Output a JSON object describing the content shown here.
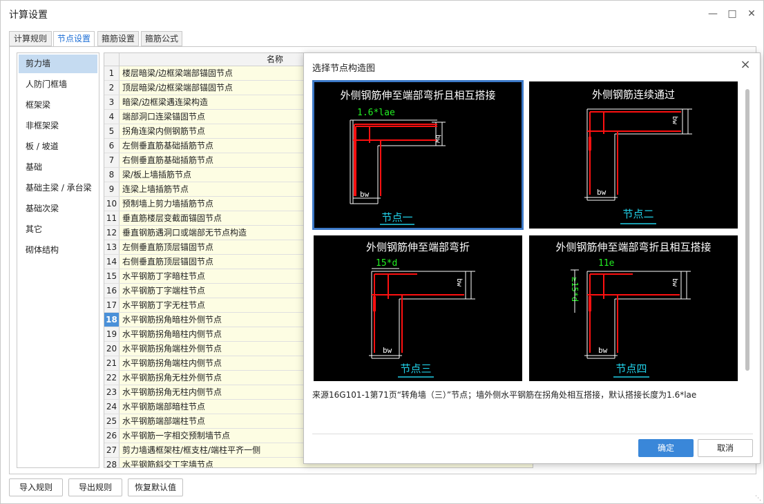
{
  "window": {
    "title": "计算设置"
  },
  "tabs": [
    {
      "label": "计算规则"
    },
    {
      "label": "节点设置"
    },
    {
      "label": "箍筋设置"
    },
    {
      "label": "箍筋公式"
    }
  ],
  "categories": [
    {
      "label": "剪力墙"
    },
    {
      "label": "人防门框墙"
    },
    {
      "label": "框架梁"
    },
    {
      "label": "非框架梁"
    },
    {
      "label": "板 / 坡道"
    },
    {
      "label": "基础"
    },
    {
      "label": "基础主梁 / 承台梁"
    },
    {
      "label": "基础次梁"
    },
    {
      "label": "其它"
    },
    {
      "label": "砌体结构"
    }
  ],
  "grid": {
    "header": "名称",
    "rows": [
      {
        "n": "1",
        "name": "楼层暗梁/边框梁端部锚固节点"
      },
      {
        "n": "2",
        "name": "顶层暗梁/边框梁端部锚固节点"
      },
      {
        "n": "3",
        "name": "暗梁/边框梁遇连梁构造"
      },
      {
        "n": "4",
        "name": "端部洞口连梁锚固节点"
      },
      {
        "n": "5",
        "name": "拐角连梁内侧钢筋节点"
      },
      {
        "n": "6",
        "name": "左侧垂直筋基础插筋节点"
      },
      {
        "n": "7",
        "name": "右侧垂直筋基础插筋节点"
      },
      {
        "n": "8",
        "name": "梁/板上墙插筋节点"
      },
      {
        "n": "9",
        "name": "连梁上墙插筋节点"
      },
      {
        "n": "10",
        "name": "预制墙上剪力墙插筋节点"
      },
      {
        "n": "11",
        "name": "垂直筋楼层变截面锚固节点"
      },
      {
        "n": "12",
        "name": "垂直钢筋遇洞口或端部无节点构造"
      },
      {
        "n": "13",
        "name": "左侧垂直筋顶层锚固节点"
      },
      {
        "n": "14",
        "name": "右侧垂直筋顶层锚固节点"
      },
      {
        "n": "15",
        "name": "水平钢筋丁字暗柱节点"
      },
      {
        "n": "16",
        "name": "水平钢筋丁字端柱节点"
      },
      {
        "n": "17",
        "name": "水平钢筋丁字无柱节点"
      },
      {
        "n": "18",
        "name": "水平钢筋拐角暗柱外侧节点"
      },
      {
        "n": "19",
        "name": "水平钢筋拐角暗柱内侧节点"
      },
      {
        "n": "20",
        "name": "水平钢筋拐角端柱外侧节点"
      },
      {
        "n": "21",
        "name": "水平钢筋拐角端柱内侧节点"
      },
      {
        "n": "22",
        "name": "水平钢筋拐角无柱外侧节点"
      },
      {
        "n": "23",
        "name": "水平钢筋拐角无柱内侧节点"
      },
      {
        "n": "24",
        "name": "水平钢筋端部暗柱节点"
      },
      {
        "n": "25",
        "name": "水平钢筋端部端柱节点"
      },
      {
        "n": "26",
        "name": "水平钢筋一字相交预制墙节点"
      },
      {
        "n": "27",
        "name": "剪力墙遇框架柱/框支柱/端柱平齐一侧"
      },
      {
        "n": "28",
        "name": "水平钢筋斜交丁字墙节点"
      }
    ],
    "current_row": "18"
  },
  "footer": {
    "import": "导入规则",
    "export": "导出规则",
    "restore": "恢复默认值"
  },
  "dialog": {
    "title": "选择节点构造图",
    "close": "×",
    "thumbs": [
      {
        "title": "外侧钢筋伸至端部弯折且相互搭接",
        "dim": "1.6*lae",
        "bw": "bw",
        "label": "节点一"
      },
      {
        "title": "外侧钢筋连续通过",
        "dim": "",
        "bw": "bw",
        "label": "节点二"
      },
      {
        "title": "外侧钢筋伸至端部弯折",
        "dim": "15*d",
        "bw": "bw",
        "label": "节点三"
      },
      {
        "title": "外侧钢筋伸至端部弯折且相互搭接",
        "dim": "11e",
        "side": "≥15*d",
        "bw": "bw",
        "label": "节点四"
      }
    ],
    "note": "来源16G101-1第71页“转角墙（三）”节点；墙外侧水平钢筋在拐角处相互搭接，默认搭接长度为1.6*lae",
    "ok": "确定",
    "cancel": "取消"
  },
  "colors": {
    "accent": "#3a87d9",
    "selected_category": "#c5dbf1",
    "name_cell": "#fdfde3",
    "rebar": "#ff1010",
    "dim_text": "#22ee22",
    "label": "#20d0e8"
  }
}
